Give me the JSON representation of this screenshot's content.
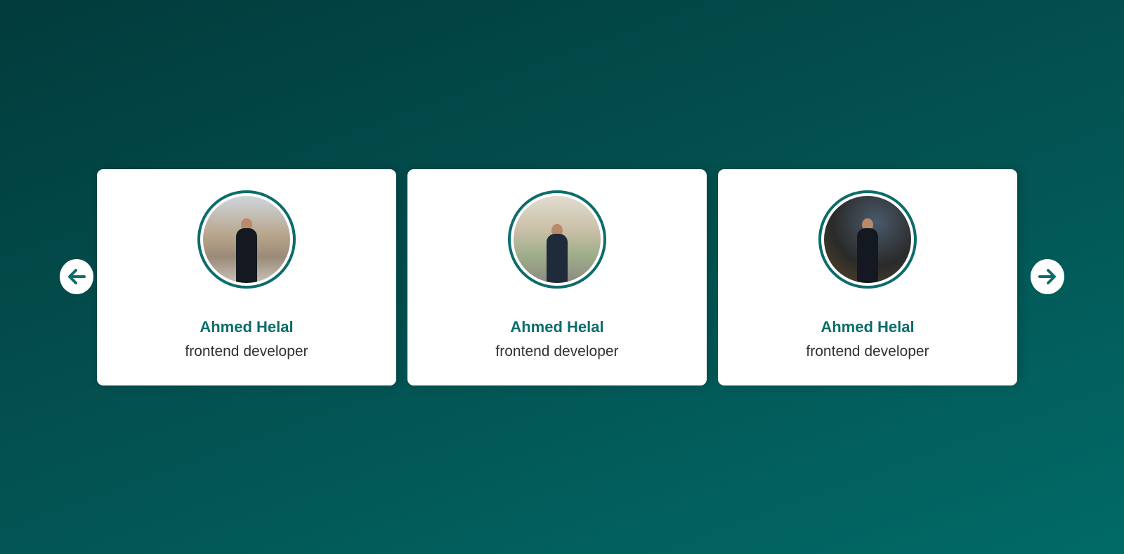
{
  "colors": {
    "accent": "#0c6d6a",
    "background_start": "#023b3c",
    "background_end": "#016a67",
    "card": "#ffffff",
    "role_text": "#2e3333"
  },
  "navigation": {
    "prev_icon": "arrow-left-icon",
    "next_icon": "arrow-right-icon"
  },
  "cards": [
    {
      "name": "Ahmed Helal",
      "role": "frontend developer",
      "avatar_icon": "profile-photo"
    },
    {
      "name": "Ahmed Helal",
      "role": "frontend developer",
      "avatar_icon": "profile-photo"
    },
    {
      "name": "Ahmed Helal",
      "role": "frontend developer",
      "avatar_icon": "profile-photo"
    }
  ]
}
